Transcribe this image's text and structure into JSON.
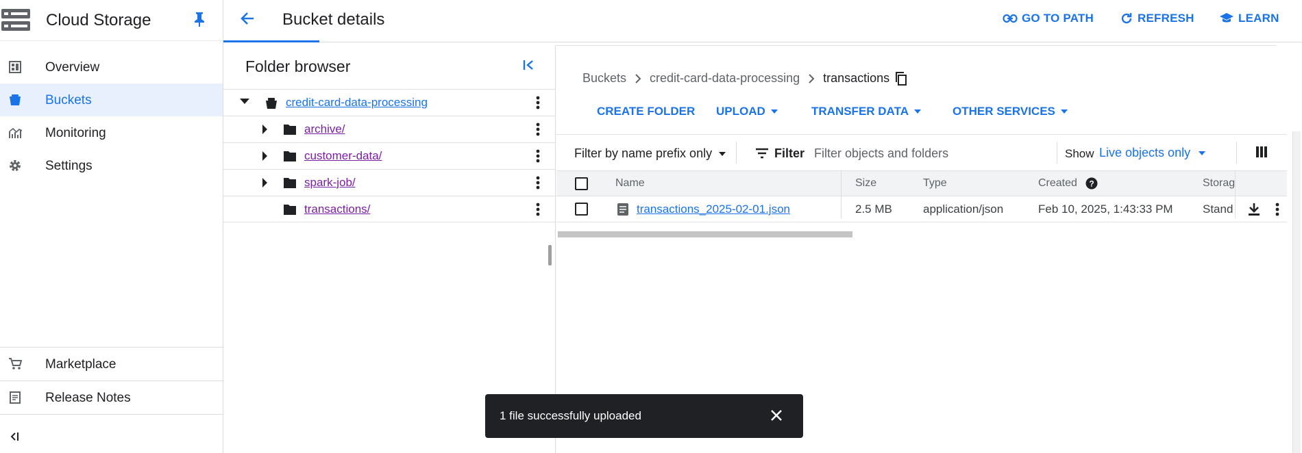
{
  "nav": {
    "product": "Cloud Storage",
    "items": [
      {
        "label": "Overview",
        "icon": "dashboard-icon"
      },
      {
        "label": "Buckets",
        "icon": "bucket-icon",
        "active": true
      },
      {
        "label": "Monitoring",
        "icon": "chart-icon"
      },
      {
        "label": "Settings",
        "icon": "gear-icon"
      }
    ],
    "bottom": [
      {
        "label": "Marketplace",
        "icon": "cart-icon"
      },
      {
        "label": "Release Notes",
        "icon": "notes-icon"
      }
    ]
  },
  "header": {
    "title": "Bucket details",
    "actions": [
      "GO TO PATH",
      "REFRESH",
      "LEARN"
    ]
  },
  "folder_browser": {
    "title": "Folder browser",
    "bucket": "credit-card-data-processing",
    "folders": [
      "archive/",
      "customer-data/",
      "spark-job/",
      "transactions/"
    ]
  },
  "breadcrumb": {
    "root": "Buckets",
    "bucket": "credit-card-data-processing",
    "current": "transactions"
  },
  "actions": [
    "CREATE FOLDER",
    "UPLOAD",
    "TRANSFER DATA",
    "OTHER SERVICES"
  ],
  "filter": {
    "prefix_label": "Filter by name prefix only",
    "filter_label": "Filter",
    "placeholder": "Filter objects and folders",
    "show_label": "Show",
    "show_value": "Live objects only"
  },
  "table": {
    "columns": [
      "Name",
      "Size",
      "Type",
      "Created",
      "Storag"
    ],
    "rows": [
      {
        "name": "transactions_2025-02-01.json",
        "size": "2.5 MB",
        "type": "application/json",
        "created": "Feb 10, 2025, 1:43:33 PM",
        "storage": "Stand"
      }
    ]
  },
  "snackbar": {
    "message": "1 file successfully uploaded"
  },
  "colors": {
    "accent": "#1a73e8",
    "visited": "#7b1fa2",
    "snackbar": "#202124"
  }
}
